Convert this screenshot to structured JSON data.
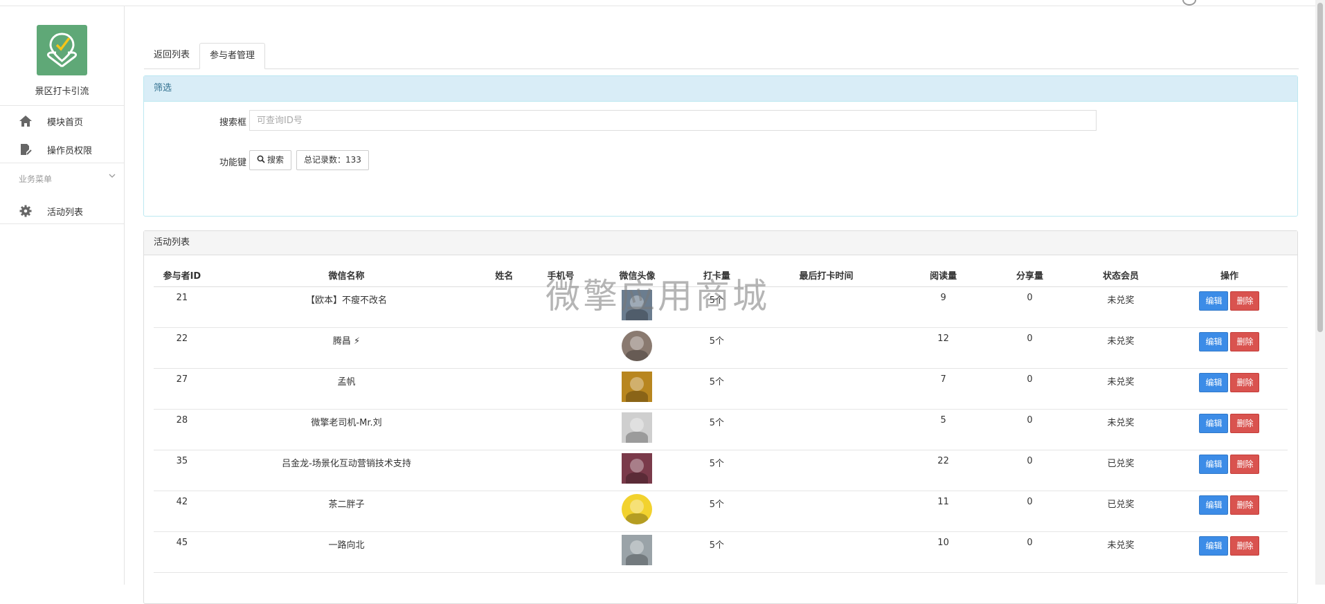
{
  "sidebar": {
    "app_name": "景区打卡引流",
    "items": [
      {
        "label": "模块首页",
        "icon": "home-icon"
      },
      {
        "label": "操作员权限",
        "icon": "doc-edit-icon"
      }
    ],
    "group_label": "业务菜单",
    "group_items": [
      {
        "label": "活动列表",
        "icon": "gear-icon"
      }
    ]
  },
  "tabs": [
    {
      "label": "返回列表",
      "active": false
    },
    {
      "label": "参与者管理",
      "active": true
    }
  ],
  "filter": {
    "title": "筛选",
    "search_label": "搜索框",
    "search_placeholder": "可查询ID号",
    "search_value": "",
    "func_label": "功能键",
    "search_button": "搜索",
    "total_label": "总记录数：133"
  },
  "list": {
    "title": "活动列表",
    "columns": [
      "参与者ID",
      "微信名称",
      "姓名",
      "手机号",
      "微信头像",
      "打卡量",
      "最后打卡时间",
      "阅读量",
      "分享量",
      "状态会员",
      "操作"
    ],
    "edit_label": "编辑",
    "delete_label": "删除",
    "rows": [
      {
        "id": "21",
        "wechat": "【欧本】不瘦不改名",
        "name": "",
        "phone": "",
        "checkins": "5个",
        "last": "",
        "reads": "9",
        "shares": "0",
        "status": "未兑奖",
        "avatar_color": "#6b7d8f"
      },
      {
        "id": "22",
        "wechat": "腾昌 ⚡",
        "name": "",
        "phone": "",
        "checkins": "5个",
        "last": "",
        "reads": "12",
        "shares": "0",
        "status": "未兑奖",
        "avatar_color": "#8a7a70"
      },
      {
        "id": "27",
        "wechat": "孟帆",
        "name": "",
        "phone": "",
        "checkins": "5个",
        "last": "",
        "reads": "7",
        "shares": "0",
        "status": "未兑奖",
        "avatar_color": "#b8861f"
      },
      {
        "id": "28",
        "wechat": "微擎老司机-Mr.刘",
        "name": "",
        "phone": "",
        "checkins": "5个",
        "last": "",
        "reads": "5",
        "shares": "0",
        "status": "未兑奖",
        "avatar_color": "#cfcfcf"
      },
      {
        "id": "35",
        "wechat": "吕金龙-场景化互动营销技术支持",
        "name": "",
        "phone": "",
        "checkins": "5个",
        "last": "",
        "reads": "22",
        "shares": "0",
        "status": "已兑奖",
        "avatar_color": "#7a3a4a"
      },
      {
        "id": "42",
        "wechat": "茶二胖子",
        "name": "",
        "phone": "",
        "checkins": "5个",
        "last": "",
        "reads": "11",
        "shares": "0",
        "status": "已兑奖",
        "avatar_color": "#f2d22e"
      },
      {
        "id": "45",
        "wechat": "一路向北",
        "name": "",
        "phone": "",
        "checkins": "5个",
        "last": "",
        "reads": "10",
        "shares": "0",
        "status": "未兑奖",
        "avatar_color": "#9aa3a8"
      }
    ]
  },
  "watermark": "微擎应用商城",
  "colors": {
    "logo_bg": "#5fa877",
    "filter_head_bg": "#d9edf7",
    "edit_btn": "#3c8ce7",
    "delete_btn": "#d9534f"
  }
}
